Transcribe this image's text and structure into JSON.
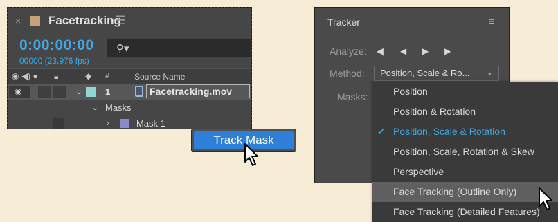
{
  "timeline": {
    "close_glyph": "×",
    "title": "Facetracking",
    "menu_glyph": "☰",
    "timecode": "0:00:00:00",
    "fps": "00000 (23.976 fps)",
    "search_icon_glyph": "⚲▾",
    "column_headers": {
      "av_icons": "◉ ◀) ●",
      "lock_icon": "🔒︎",
      "label_icon": "◆",
      "number": "#",
      "source_name": "Source Name"
    },
    "layer": {
      "number": "1",
      "source_name": "Facetracking.mov",
      "label_color": "#8fd5d0"
    },
    "masks_group": "Masks",
    "mask": {
      "name": "Mask 1",
      "color": "#8888cc"
    },
    "chevron_down": "⌄",
    "chevron_right": "›"
  },
  "track_mask": {
    "label": "Track Mask",
    "color": "#2d7fd7"
  },
  "tracker": {
    "title": "Tracker",
    "menu_glyph": "≡",
    "analyze_label": "Analyze:",
    "analyze_buttons": [
      "◀|",
      "◀",
      "▶",
      "|▶"
    ],
    "method_label": "Method:",
    "method_value": "Position, Scale & Ro...",
    "method_chevron": "⌄",
    "masks_label": "Masks:"
  },
  "dropdown": {
    "check_glyph": "✔",
    "accent": "#3ea9e4",
    "items": [
      {
        "label": "Position"
      },
      {
        "label": "Position & Rotation"
      },
      {
        "label": "Position, Scale & Rotation",
        "selected": true
      },
      {
        "label": "Position, Scale, Rotation & Skew"
      },
      {
        "label": "Perspective"
      },
      {
        "label": "Face Tracking (Outline Only)",
        "hover": true
      },
      {
        "label": "Face Tracking (Detailed Features)"
      }
    ]
  }
}
